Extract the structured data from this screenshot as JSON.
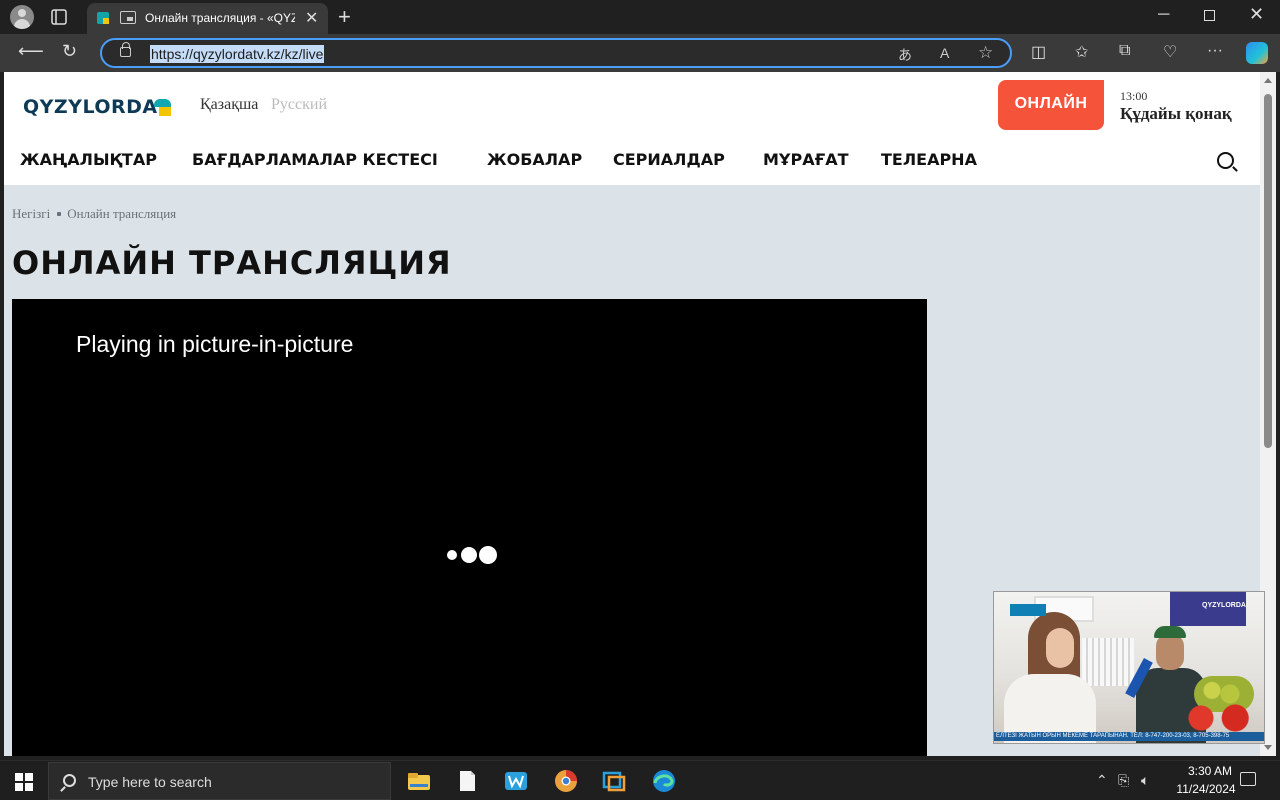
{
  "browser": {
    "tab_title": "Онлайн трансляция - «QYZ",
    "url": "https://qyzylordatv.kz/kz/live",
    "icons": [
      "profile-icon",
      "tab-actions-icon",
      "pip-icon",
      "close-icon",
      "new-tab-icon",
      "back-icon",
      "refresh-icon",
      "lock-icon",
      "translate-icon",
      "read-aloud-icon",
      "favorite-star-icon",
      "split-screen-icon",
      "favorites-icon",
      "collections-icon",
      "performance-icon",
      "more-icon",
      "copilot-icon"
    ]
  },
  "site": {
    "logo": "QYZYLORDA",
    "lang_kz": "Қазақша",
    "lang_ru": "Русский",
    "online_button": "ОНЛАЙН",
    "schedule_time": "13:00",
    "schedule_show": "Құдайы қонақ",
    "nav": [
      "ЖАҢАЛЫҚТАР",
      "БАҒДАРЛАМАЛАР КЕСТЕСІ",
      "ЖОБАЛАР",
      "СЕРИАЛДАР",
      "МҰРАҒАТ",
      "ТЕЛЕАРНА"
    ],
    "breadcrumb": [
      "Негізгі",
      "Онлайн трансляция"
    ],
    "page_title": "ОНЛАЙН ТРАНСЛЯЦИЯ",
    "player_message": "Playing in picture-in-picture"
  },
  "pip": {
    "channel_tag": "QYZYLORDA",
    "ticker": "ЕЛТЕЗІ ЖАТЫН ОРЫН МЕКЕМЕ ТАРАПЫНАН. ТЕЛ: 8-747-200-23-03, 8-705-398-75"
  },
  "taskbar": {
    "search_placeholder": "Type here to search",
    "time": "3:30 AM",
    "date": "11/24/2024"
  }
}
